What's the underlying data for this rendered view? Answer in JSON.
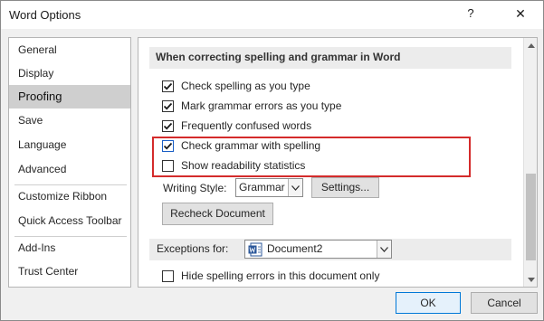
{
  "window": {
    "title": "Word Options",
    "help_label": "?",
    "close_label": "✕"
  },
  "sidebar": {
    "items": [
      {
        "label": "General"
      },
      {
        "label": "Display"
      },
      {
        "label": "Proofing",
        "selected": true
      },
      {
        "label": "Save"
      },
      {
        "label": "Language"
      },
      {
        "label": "Advanced"
      },
      {
        "label": "Customize Ribbon"
      },
      {
        "label": "Quick Access Toolbar"
      },
      {
        "label": "Add-Ins"
      },
      {
        "label": "Trust Center"
      }
    ]
  },
  "proofing": {
    "section_title": "When correcting spelling and grammar in Word",
    "options": [
      {
        "label": "Check spelling as you type",
        "checked": true
      },
      {
        "label": "Mark grammar errors as you type",
        "checked": true
      },
      {
        "label": "Frequently confused words",
        "checked": true
      },
      {
        "label": "Check grammar with spelling",
        "checked": true
      },
      {
        "label": "Show readability statistics",
        "checked": false
      }
    ],
    "writing_style_label": "Writing Style:",
    "writing_style_value": "Grammar",
    "settings_button": "Settings...",
    "recheck_button": "Recheck Document",
    "exceptions_label": "Exceptions for:",
    "exceptions_document": "Document2",
    "hide_spelling_label": "Hide spelling errors in this document only",
    "hide_spelling_checked": false
  },
  "footer": {
    "ok_label": "OK",
    "cancel_label": "Cancel"
  },
  "colors": {
    "highlight_border": "#d42b2b",
    "selected_nav": "#cfcfcf",
    "ok_border": "#0078d7"
  }
}
